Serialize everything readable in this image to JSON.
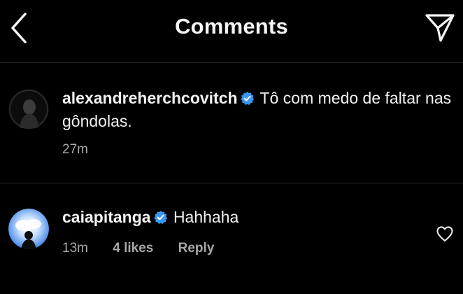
{
  "header": {
    "title": "Comments"
  },
  "comments": [
    {
      "username": "alexandreherchcovitch",
      "verified": true,
      "text": "Tô com medo de faltar nas gôndolas.",
      "time": "27m"
    },
    {
      "username": "caiapitanga",
      "verified": true,
      "text": "Hahhaha",
      "time": "13m",
      "likes": "4 likes",
      "reply_label": "Reply"
    }
  ],
  "colors": {
    "background": "#000000",
    "verified_badge": "#3897f0",
    "secondary_text": "#a8a8a8"
  },
  "icons": [
    "back-chevron-icon",
    "direct-share-icon",
    "verified-badge-icon",
    "heart-icon"
  ]
}
